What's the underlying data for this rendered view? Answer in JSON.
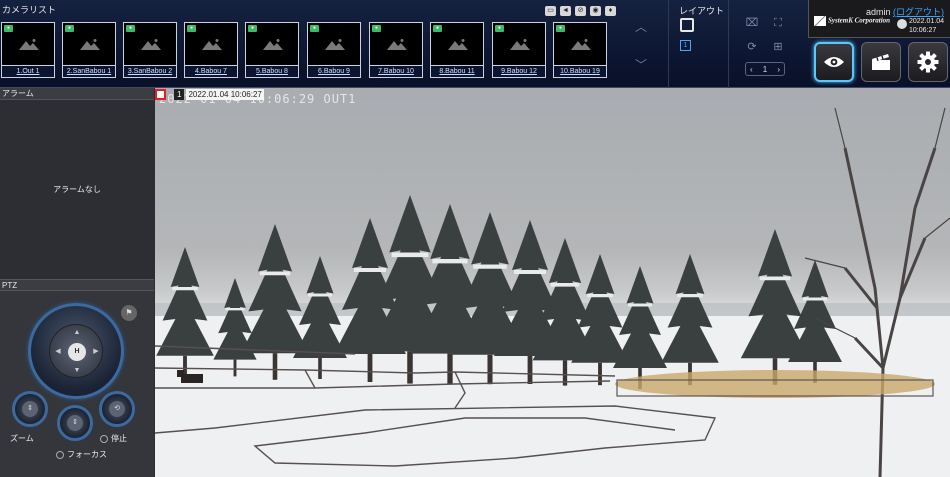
{
  "camera_list": {
    "title": "カメラリスト",
    "cameras": [
      {
        "label": "1.Out 1"
      },
      {
        "label": "2.SanBabou 1"
      },
      {
        "label": "3.SanBabou 2"
      },
      {
        "label": "4.Babou 7"
      },
      {
        "label": "5.Babou 8"
      },
      {
        "label": "6.Babou 9"
      },
      {
        "label": "7.Babou 10"
      },
      {
        "label": "8.Babou 11"
      },
      {
        "label": "9.Babou 12"
      },
      {
        "label": "10.Babou 19"
      }
    ]
  },
  "layout": {
    "title": "レイアウト",
    "selected": "1"
  },
  "pager": {
    "page": "1"
  },
  "user": {
    "name": "admin",
    "logout": "(ログアウト)"
  },
  "company": {
    "name": "SystemK Corporation"
  },
  "clock": {
    "date": "2022.01.04",
    "time": "10:06:27"
  },
  "alarm": {
    "title": "アラーム",
    "empty": "アラームなし"
  },
  "ptz": {
    "title": "PTZ",
    "zoom": "ズーム",
    "stop": "停止",
    "focus": "フォーカス",
    "home": "H"
  },
  "video": {
    "camera_number": "1",
    "timestamp": "2022.01.04 10:06:27",
    "osd": "2022-01-04 10:06:29  OUT1"
  },
  "colors": {
    "accent": "#5ac8ff",
    "link": "#3aa4ff",
    "rec_green": "#3fb86a",
    "rec_red": "#d22222"
  }
}
